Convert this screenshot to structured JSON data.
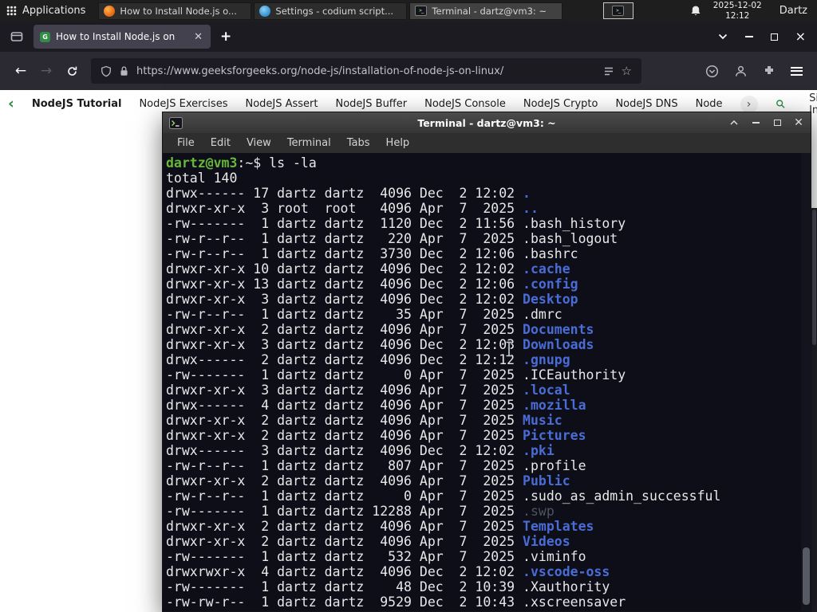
{
  "panel": {
    "applications_label": "Applications",
    "window_buttons": [
      {
        "title": "How to Install Node.js o...",
        "icon": "firefox-icon"
      },
      {
        "title": "Settings - codium script...",
        "icon": "settings-icon"
      },
      {
        "title": "Terminal - dartz@vm3: ~",
        "icon": "terminal-icon"
      }
    ],
    "clock": {
      "date": "2025-12-02",
      "time": "12:12"
    },
    "user_label": "Dartz"
  },
  "browser": {
    "tab_title": "How to Install Node.js on",
    "url": "https://www.geeksforgeeks.org/node-js/installation-of-node-js-on-linux/"
  },
  "site_nav": {
    "links": [
      "NodeJS Tutorial",
      "NodeJS Exercises",
      "NodeJS Assert",
      "NodeJS Buffer",
      "NodeJS Console",
      "NodeJS Crypto",
      "NodeJS DNS",
      "Node"
    ],
    "sign_in_label": "Sign In"
  },
  "terminal": {
    "title": "Terminal - dartz@vm3: ~",
    "menu": [
      "File",
      "Edit",
      "View",
      "Terminal",
      "Tabs",
      "Help"
    ],
    "prompt": {
      "user_host": "dartz@vm3",
      "separator": ":",
      "path": "~",
      "symbol": "$ ",
      "command": "ls -la"
    },
    "total_line": "total 140",
    "palette": {
      "background": "#0d0e17",
      "text": "#e8e8ea",
      "prompt_green": "#67b83a",
      "dir_blue": "#4a6cd6",
      "dim": "#50545c"
    },
    "listing": [
      {
        "pre": "drwx------ 17 dartz dartz  4096 Dec  2 12:02 ",
        "name": ".",
        "type": "dir"
      },
      {
        "pre": "drwxr-xr-x  3 root  root   4096 Apr  7  2025 ",
        "name": "..",
        "type": "dir"
      },
      {
        "pre": "-rw-------  1 dartz dartz  1120 Dec  2 11:56 ",
        "name": ".bash_history",
        "type": "file"
      },
      {
        "pre": "-rw-r--r--  1 dartz dartz   220 Apr  7  2025 ",
        "name": ".bash_logout",
        "type": "file"
      },
      {
        "pre": "-rw-r--r--  1 dartz dartz  3730 Dec  2 12:06 ",
        "name": ".bashrc",
        "type": "file"
      },
      {
        "pre": "drwxr-xr-x 10 dartz dartz  4096 Dec  2 12:02 ",
        "name": ".cache",
        "type": "dir"
      },
      {
        "pre": "drwxr-xr-x 13 dartz dartz  4096 Dec  2 12:06 ",
        "name": ".config",
        "type": "dir"
      },
      {
        "pre": "drwxr-xr-x  3 dartz dartz  4096 Dec  2 12:02 ",
        "name": "Desktop",
        "type": "dir"
      },
      {
        "pre": "-rw-r--r--  1 dartz dartz    35 Apr  7  2025 ",
        "name": ".dmrc",
        "type": "file"
      },
      {
        "pre": "drwxr-xr-x  2 dartz dartz  4096 Apr  7  2025 ",
        "name": "Documents",
        "type": "dir"
      },
      {
        "pre": "drwxr-xr-x  3 dartz dartz  4096 Dec  2 12:03 ",
        "name": "Downloads",
        "type": "dir"
      },
      {
        "pre": "drwx------  2 dartz dartz  4096 Dec  2 12:12 ",
        "name": ".gnupg",
        "type": "dir"
      },
      {
        "pre": "-rw-------  1 dartz dartz     0 Apr  7  2025 ",
        "name": ".ICEauthority",
        "type": "file"
      },
      {
        "pre": "drwxr-xr-x  3 dartz dartz  4096 Apr  7  2025 ",
        "name": ".local",
        "type": "dir"
      },
      {
        "pre": "drwx------  4 dartz dartz  4096 Apr  7  2025 ",
        "name": ".mozilla",
        "type": "dir"
      },
      {
        "pre": "drwxr-xr-x  2 dartz dartz  4096 Apr  7  2025 ",
        "name": "Music",
        "type": "dir"
      },
      {
        "pre": "drwxr-xr-x  2 dartz dartz  4096 Apr  7  2025 ",
        "name": "Pictures",
        "type": "dir"
      },
      {
        "pre": "drwx------  3 dartz dartz  4096 Dec  2 12:02 ",
        "name": ".pki",
        "type": "dir"
      },
      {
        "pre": "-rw-r--r--  1 dartz dartz   807 Apr  7  2025 ",
        "name": ".profile",
        "type": "file"
      },
      {
        "pre": "drwxr-xr-x  2 dartz dartz  4096 Apr  7  2025 ",
        "name": "Public",
        "type": "dir"
      },
      {
        "pre": "-rw-r--r--  1 dartz dartz     0 Apr  7  2025 ",
        "name": ".sudo_as_admin_successful",
        "type": "file"
      },
      {
        "pre": "-rw-------  1 dartz dartz 12288 Apr  7  2025 ",
        "name": ".swp",
        "type": "dim"
      },
      {
        "pre": "drwxr-xr-x  2 dartz dartz  4096 Apr  7  2025 ",
        "name": "Templates",
        "type": "dir"
      },
      {
        "pre": "drwxr-xr-x  2 dartz dartz  4096 Apr  7  2025 ",
        "name": "Videos",
        "type": "dir"
      },
      {
        "pre": "-rw-------  1 dartz dartz   532 Apr  7  2025 ",
        "name": ".viminfo",
        "type": "file"
      },
      {
        "pre": "drwxrwxr-x  4 dartz dartz  4096 Dec  2 12:02 ",
        "name": ".vscode-oss",
        "type": "dir"
      },
      {
        "pre": "-rw-------  1 dartz dartz    48 Dec  2 10:39 ",
        "name": ".Xauthority",
        "type": "file"
      },
      {
        "pre": "-rw-rw-r--  1 dartz dartz  9529 Dec  2 10:43 ",
        "name": ".xscreensaver",
        "type": "file"
      }
    ]
  }
}
